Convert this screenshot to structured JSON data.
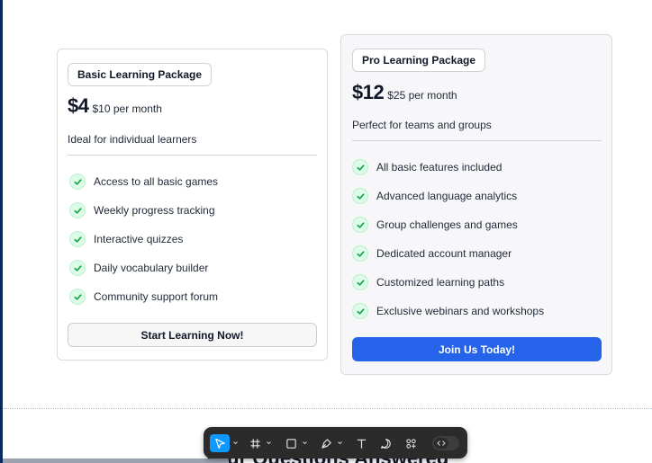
{
  "pricing": {
    "basic": {
      "badge": "Basic Learning Package",
      "price": "$4",
      "price_note": "$10 per month",
      "tagline": "Ideal for individual learners",
      "features": [
        "Access to all basic games",
        "Weekly progress tracking",
        "Interactive quizzes",
        "Daily vocabulary builder",
        "Community support forum"
      ],
      "cta": "Start Learning Now!"
    },
    "pro": {
      "badge": "Pro Learning Package",
      "price": "$12",
      "price_note": "$25 per month",
      "tagline": "Perfect for teams and groups",
      "features": [
        "All basic features included",
        "Advanced language analytics",
        "Group challenges and games",
        "Dedicated account manager",
        "Customized learning paths",
        "Exclusive webinars and workshops"
      ],
      "cta": "Join Us Today!"
    }
  },
  "faq": {
    "heading": "Your Questions Answered"
  },
  "toolbar": {
    "tools": [
      "move-tool",
      "frame-tool",
      "shape-tool",
      "pen-tool",
      "text-tool",
      "comment-tool",
      "actions-tool",
      "dev-mode-toggle"
    ],
    "active_tool": "move-tool"
  },
  "colors": {
    "accent": "#2563eb",
    "check_bg": "#dcfce7",
    "check": "#16a34a",
    "toolbar_bg": "#2b2b2b",
    "toolbar_active": "#0d99ff"
  }
}
